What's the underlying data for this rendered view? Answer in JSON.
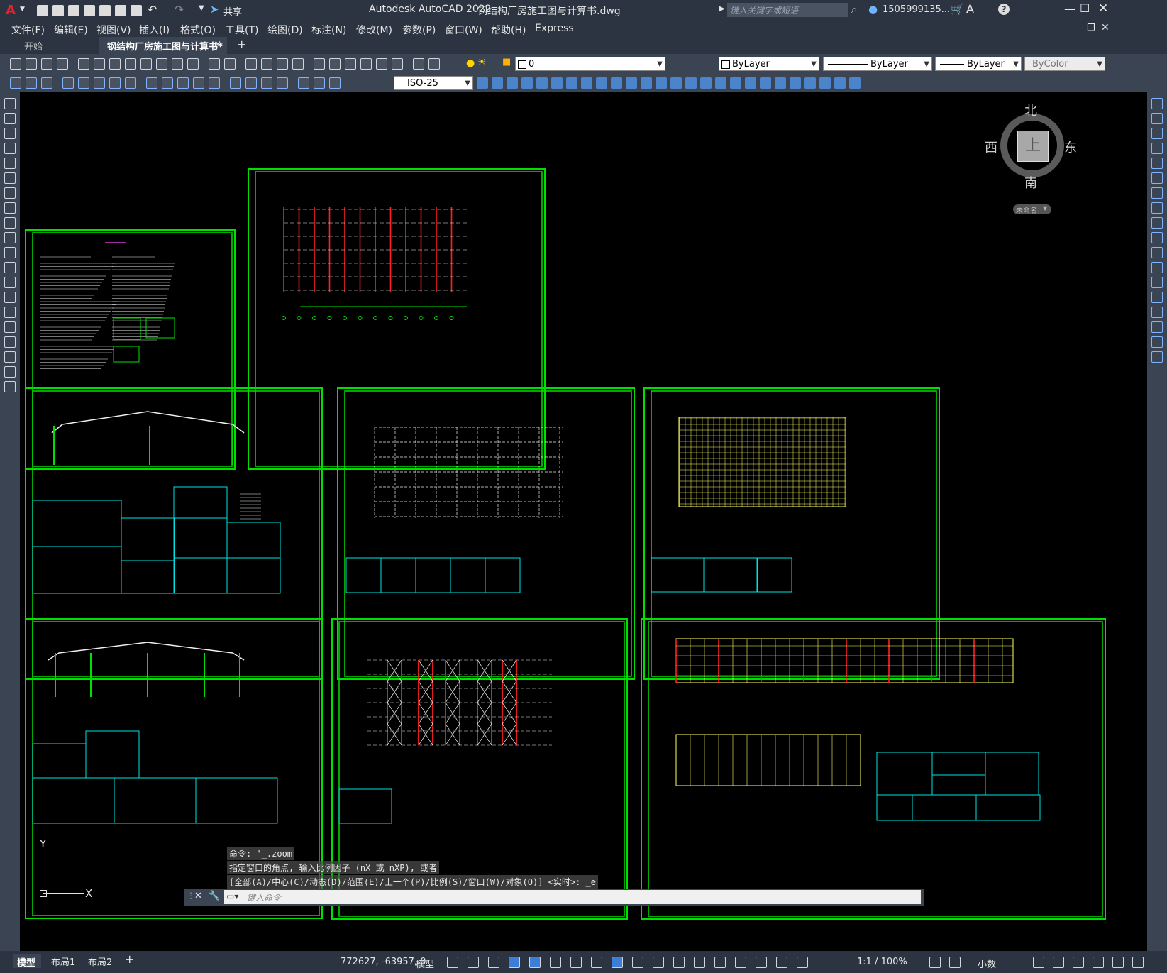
{
  "app": {
    "title": "Autodesk AutoCAD 2022",
    "document": "钢结构厂房施工图与计算书.dwg",
    "share_label": "共享",
    "search_placeholder": "键入关键字或短语",
    "user": "1505999135...",
    "help": "?"
  },
  "menu": [
    "文件(F)",
    "编辑(E)",
    "视图(V)",
    "插入(I)",
    "格式(O)",
    "工具(T)",
    "绘图(D)",
    "标注(N)",
    "修改(M)",
    "参数(P)",
    "窗口(W)",
    "帮助(H)",
    "Express"
  ],
  "tabs": [
    {
      "label": "开始",
      "active": false
    },
    {
      "label": "钢结构厂房施工图与计算书*",
      "active": true
    }
  ],
  "toolbar": {
    "layer_value": "0",
    "dimstyle": "ISO-25",
    "color": "ByLayer",
    "linetype": "ByLayer",
    "lineweight": "ByLayer",
    "plotstyle": "ByColor"
  },
  "viewcube": {
    "north": "北",
    "south": "南",
    "east": "东",
    "west": "西",
    "top": "上",
    "wcs": "未命名"
  },
  "ucs": {
    "y": "Y",
    "x": "X"
  },
  "command": {
    "history": [
      "命令: '_.zoom",
      "指定窗口的角点, 输入比例因子 (nX 或 nXP), 或者",
      "[全部(A)/中心(C)/动态(D)/范围(E)/上一个(P)/比例(S)/窗口(W)/对象(O)] <实时>: _e"
    ],
    "placeholder": "键入命令"
  },
  "layout_tabs": [
    "模型",
    "布局1",
    "布局2"
  ],
  "status": {
    "coords": "772627, -63957, 0",
    "model": "模型",
    "scale": "1:1 / 100%",
    "units": "小数"
  },
  "colors": {
    "frame": "#00e000",
    "cyan": "#00e0e0",
    "red": "#ff2020",
    "yellow": "#ffff60",
    "white": "#f0f0f0",
    "magenta": "#ff40ff"
  }
}
